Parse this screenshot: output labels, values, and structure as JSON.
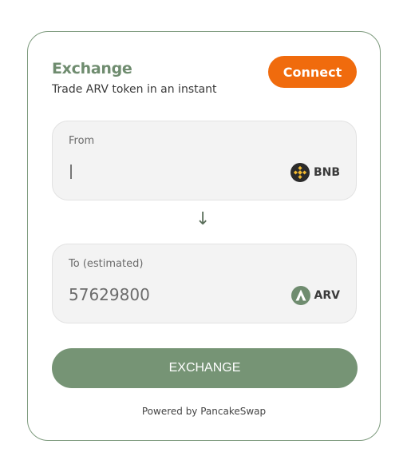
{
  "widget": {
    "title": "Exchange",
    "subtitle": "Trade ARV token in an instant",
    "connect_label": "Connect"
  },
  "from": {
    "label": "From",
    "value": "",
    "token": {
      "symbol": "BNB",
      "icon": "bnb-icon"
    }
  },
  "swap_direction_icon": "arrow-down-icon",
  "to": {
    "label": "To (estimated)",
    "value": "57629800",
    "token": {
      "symbol": "ARV",
      "icon": "arv-icon"
    }
  },
  "exchange_label": "EXCHANGE",
  "footer": {
    "powered_by": "Powered by PancakeSwap"
  },
  "colors": {
    "accent_green": "#769475",
    "connect_orange": "#f06b0d",
    "title_green": "#6f8c6f"
  }
}
